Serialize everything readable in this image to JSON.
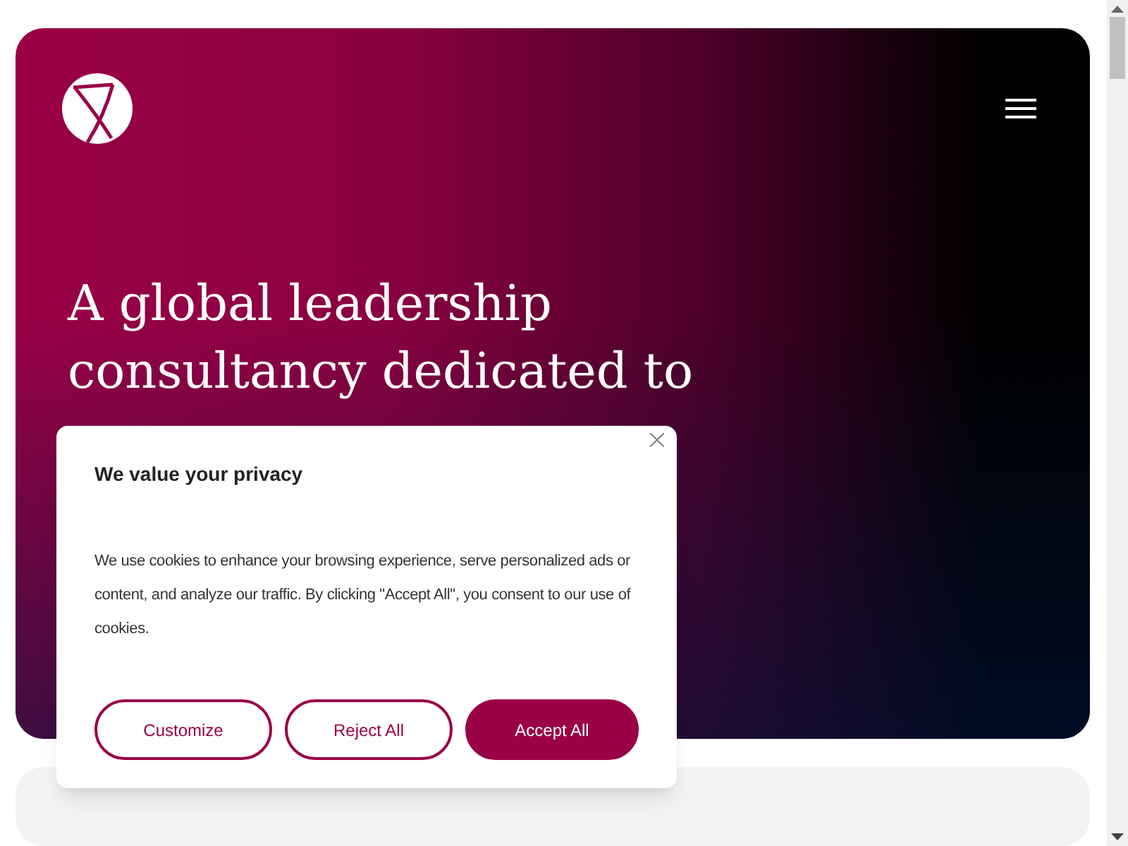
{
  "hero": {
    "heading_lines": [
      "A global leadership",
      "consultancy dedicated to"
    ]
  },
  "cookie_dialog": {
    "title": "We value your privacy",
    "body": "We use cookies to enhance your browsing experience, serve personalized ads or content, and analyze our traffic. By clicking \"Accept All\", you consent to our use of cookies.",
    "buttons": [
      {
        "label": "Customize",
        "kind": "outline"
      },
      {
        "label": "Reject All",
        "kind": "outline"
      },
      {
        "label": "Accept All",
        "kind": "filled"
      }
    ]
  }
}
